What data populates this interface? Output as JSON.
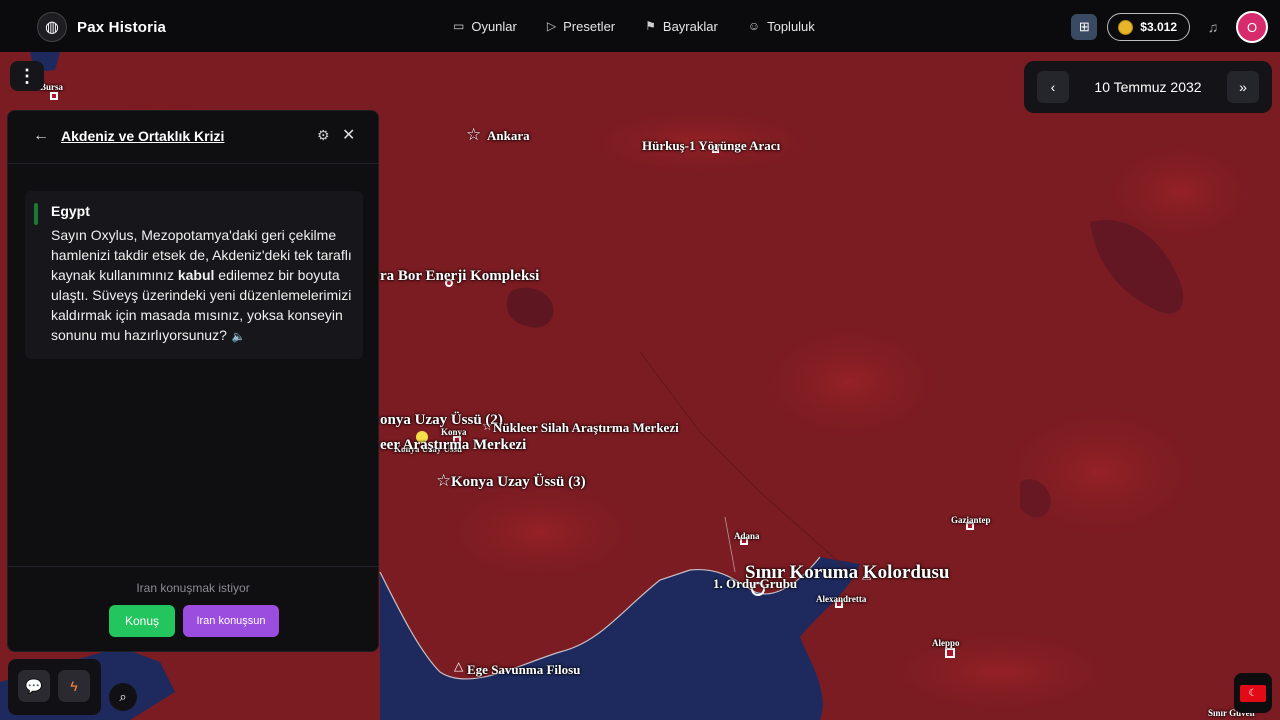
{
  "nav": {
    "brand": "Pax Historia",
    "links": [
      {
        "icon": "gamepad-icon",
        "label": "Oyunlar"
      },
      {
        "icon": "play-icon",
        "label": "Presetler"
      },
      {
        "icon": "flag-icon",
        "label": "Bayraklar"
      },
      {
        "icon": "users-icon",
        "label": "Topluluk"
      }
    ],
    "coins": "$3.012",
    "avatar_initial": "O"
  },
  "date": {
    "label": "10 Temmuz 2032"
  },
  "panel": {
    "title": "Akdeniz ve Ortaklık Krizi",
    "message": {
      "sender": "Egypt",
      "text_before": "Sayın Oxylus, Mezopotamya'daki geri çekilme hamlenizi takdir etsek de, Akdeniz'deki tek taraflı kaynak kullanımınız ",
      "text_bold": "kabul",
      "text_after": " edilemez bir boyuta ulaştı. Süveyş üzerindeki yeni düzenlemelerimizi kaldırmak için masada mısınız, yoksa konseyin sonunu mu hazırlıyorsunuz?"
    },
    "footer_note": "Iran konuşmak istiyor",
    "talk_button": "Konuş",
    "iran_button": "Iran konuşsun"
  },
  "map_labels": {
    "bursa": "Bursa",
    "ankara": "Ankara",
    "hurkus": "Hürkuş-1 Yörünge Aracı",
    "bor": "ra Bor Enerji Kompleksi",
    "konya_uzay2": "onya Uzay Üssü (2)",
    "konya": "Konya",
    "konya_small": "Konya Uzay Üssü",
    "nukleer": "Nükleer Silah Araştırma Merkezi",
    "arastirma": "eer Araştırma Merkezi",
    "konya_uzay3": "Konya Uzay Üssü (3)",
    "adana": "Adana",
    "gaziantep": "Gaziantep",
    "sinir": "Sınır Koruma Kolordusu",
    "ordu": "1. Ordu Grubu",
    "iskenderun": "Alexandretta",
    "aleppo": "Aleppo",
    "ege": "Ege Savunma Filosu",
    "sinir_guv": "Sınır Güven"
  },
  "colors": {
    "territory": "#7a1c22",
    "sea": "#1e2a5e",
    "talk_button": "#22c55e",
    "iran_button": "#9b4de0"
  }
}
